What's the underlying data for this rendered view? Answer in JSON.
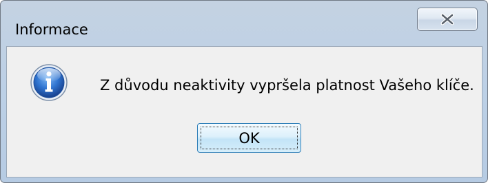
{
  "dialog": {
    "title": "Informace",
    "message": "Z důvodu neaktivity vypršela platnost Vašeho klíče.",
    "ok_label": "OK",
    "icon": "information-icon",
    "close_icon": "close-icon"
  }
}
